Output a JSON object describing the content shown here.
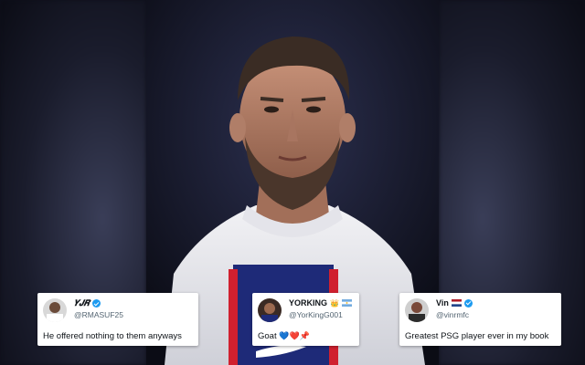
{
  "tweets": [
    {
      "display_name": "𝒀𝑱𝑹",
      "handle": "@RMASUF25",
      "text": "He offered nothing to them anyways",
      "verified": true
    },
    {
      "display_name": "YORKING",
      "handle": "@YorKingG001",
      "text": "Goat",
      "emojis": "💙❤️📌",
      "verified": false,
      "flag": "argentina-flag-icon"
    },
    {
      "display_name": "Vin",
      "handle": "@vinrmfc",
      "text": "Greatest PSG player ever in my book",
      "verified": true,
      "flag": "netherlands-flag-icon"
    }
  ],
  "colors": {
    "verified_blue": "#1d9bf0",
    "jersey_white": "#e9e9ee",
    "kit_blue": "#1e2a78",
    "kit_red": "#d0202f"
  }
}
